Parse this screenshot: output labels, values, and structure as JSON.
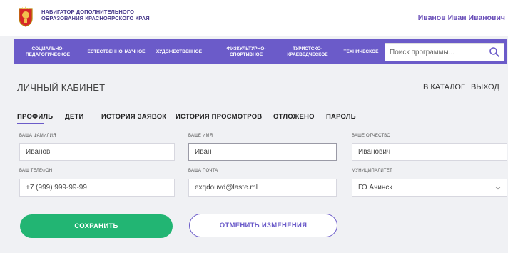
{
  "header": {
    "brand_line1": "НАВИГАТОР ДОПОЛНИТЕЛЬНОГО",
    "brand_line2": "ОБРАЗОВАНИЯ КРАСНОЯРСКОГО КРАЯ",
    "user_name": "Иванов Иван Иванович"
  },
  "nav": {
    "items": [
      {
        "line1": "СОЦИАЛЬНО-",
        "line2": "ПЕДАГОГИЧЕСКОЕ"
      },
      {
        "line1": "ЕСТЕСТВЕННОНАУЧНОЕ",
        "line2": ""
      },
      {
        "line1": "ХУДОЖЕСТВЕННОЕ",
        "line2": ""
      },
      {
        "line1": "ФИЗКУЛЬТУРНО-",
        "line2": "СПОРТИВНОЕ"
      },
      {
        "line1": "ТУРИСТСКО-",
        "line2": "КРАЕВЕДЧЕСКОЕ"
      },
      {
        "line1": "ТЕХНИЧЕСКОЕ",
        "line2": ""
      }
    ],
    "search_placeholder": "Поиск программы..."
  },
  "page": {
    "title": "ЛИЧНЫЙ КАБИНЕТ",
    "catalog_link": "В КАТАЛОГ",
    "logout_link": "ВЫХОД"
  },
  "tabs": [
    "ПРОФИЛЬ",
    "ДЕТИ",
    "ИСТОРИЯ ЗАЯВОК",
    "ИСТОРИЯ ПРОСМОТРОВ",
    "ОТЛОЖЕНО",
    "ПАРОЛЬ"
  ],
  "active_tab": "ПРОФИЛЬ",
  "form": {
    "last_name": {
      "label": "ВАША ФАМИЛИЯ",
      "value": "Иванов"
    },
    "first_name": {
      "label": "ВАШЕ ИМЯ",
      "value": "Иван"
    },
    "patronymic": {
      "label": "ВАШЕ ОТЧЕСТВО",
      "value": "Иванович"
    },
    "phone": {
      "label": "ВАШ ТЕЛЕФОН",
      "value": "+7 (999) 999-99-99"
    },
    "email": {
      "label": "ВАША ПОЧТА",
      "value": "exqdouvd@laste.ml"
    },
    "municipality": {
      "label": "МУНИЦИПАЛИТЕТ",
      "value": "ГО Ачинск"
    }
  },
  "buttons": {
    "save": "СОХРАНИТЬ",
    "cancel": "ОТМЕНИТЬ ИЗМЕНЕНИЯ"
  },
  "colors": {
    "accent": "#6b5bc9",
    "save": "#22b573",
    "page_bg": "#f0f1f4"
  }
}
